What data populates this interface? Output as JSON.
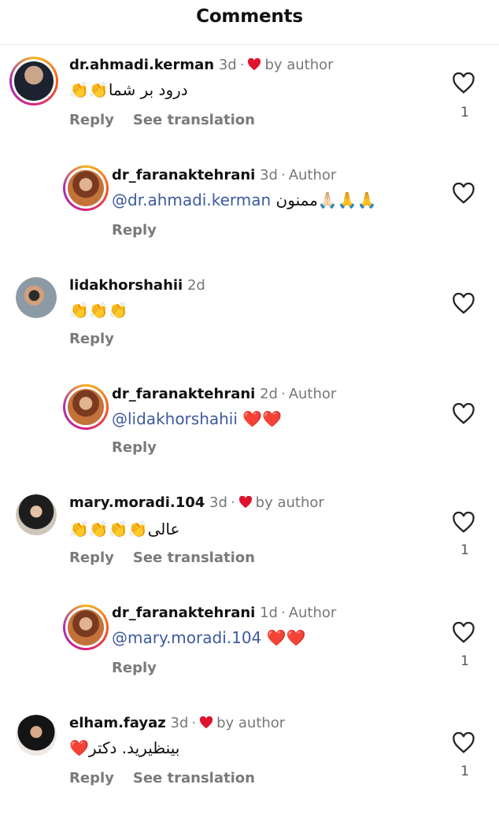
{
  "header": {
    "title": "Comments"
  },
  "comments": [
    {
      "username": "dr.ahmadi.kerman",
      "time": "3d",
      "badge": "by author",
      "text": "درود بر شما",
      "emoji": "👏👏",
      "reply": "Reply",
      "see_translation": "See translation",
      "likes": "1"
    },
    {
      "username": "dr_faranaktehrani",
      "time": "3d",
      "badge": "Author",
      "mention": "@dr.ahmadi.kerman",
      "text": "ممنون",
      "emoji": "🙏🏻🙏🙏",
      "reply": "Reply"
    },
    {
      "username": "lidakhorshahii",
      "time": "2d",
      "emoji": "👏👏👏",
      "reply": "Reply"
    },
    {
      "username": "dr_faranaktehrani",
      "time": "2d",
      "badge": "Author",
      "mention": "@lidakhorshahii",
      "emoji": "❤️❤️",
      "reply": "Reply"
    },
    {
      "username": "mary.moradi.104",
      "time": "3d",
      "badge": "by author",
      "text": "عالی",
      "emoji": "👏👏👏👏",
      "reply": "Reply",
      "see_translation": "See translation",
      "likes": "1"
    },
    {
      "username": "dr_faranaktehrani",
      "time": "1d",
      "badge": "Author",
      "mention": "@mary.moradi.104",
      "emoji": "❤️❤️",
      "reply": "Reply",
      "likes": "1"
    },
    {
      "username": "elham.fayaz",
      "time": "3d",
      "badge": "by author",
      "text": "بینظیرید. دکتر",
      "emoji": "❤️",
      "reply": "Reply",
      "see_translation": "See translation",
      "likes": "1"
    }
  ],
  "colors": {
    "heart": "#e0132c",
    "mention": "#3d5a9e",
    "muted": "#777777"
  },
  "icons": {
    "like": "heart-outline-icon",
    "author_like": "heart-filled-icon"
  }
}
